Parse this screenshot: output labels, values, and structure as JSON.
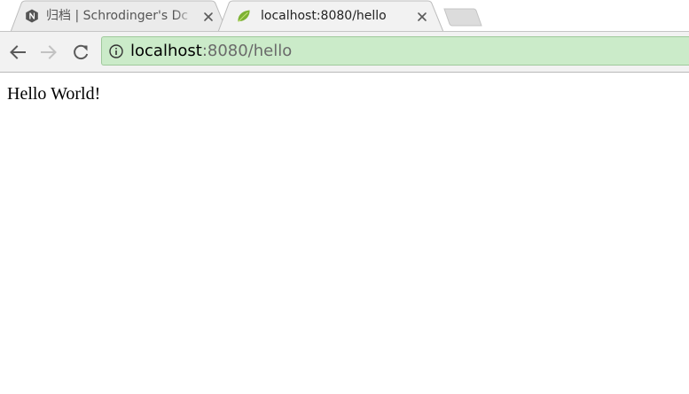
{
  "tabs": [
    {
      "title": "归档 | Schrodinger's Dc",
      "favicon": "hexagon-n-icon",
      "active": false
    },
    {
      "title": "localhost:8080/hello",
      "favicon": "spring-leaf-icon",
      "active": true
    }
  ],
  "toolbar": {
    "back_icon": "arrow-left-icon",
    "forward_icon": "arrow-right-icon",
    "reload_icon": "reload-icon"
  },
  "omnibox": {
    "security_icon": "info-icon",
    "url_host": "localhost",
    "url_rest": ":8080/hello",
    "background": "#cbebc9"
  },
  "page": {
    "body_text": "Hello World!"
  }
}
